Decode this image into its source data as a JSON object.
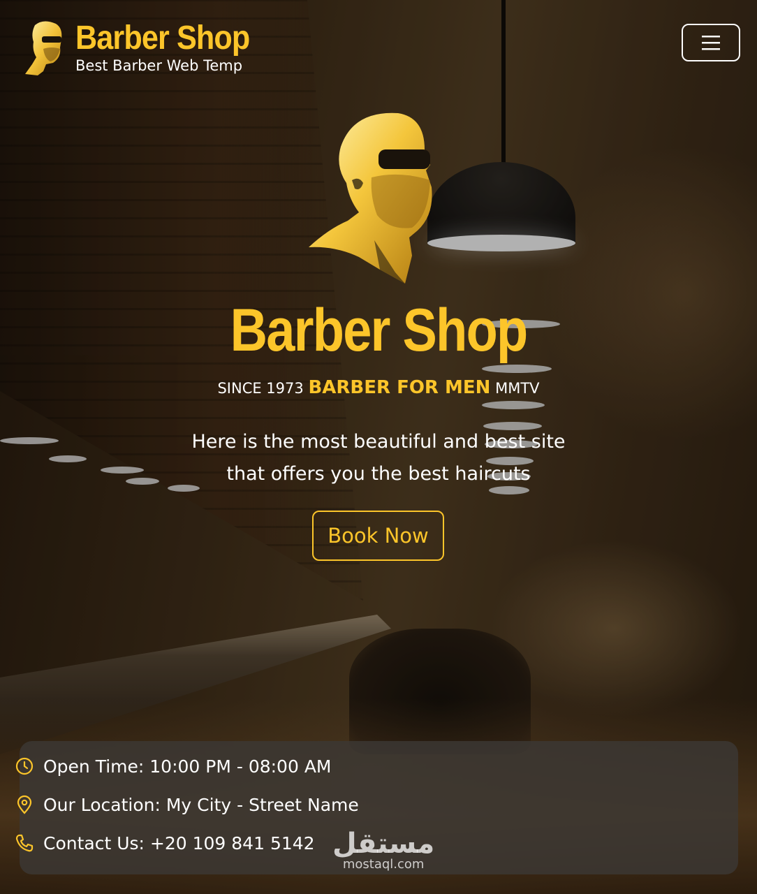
{
  "header": {
    "brand_title": "Barber Shop",
    "brand_subtitle": "Best Barber Web Temp",
    "menu_icon": "hamburger-icon"
  },
  "hero": {
    "title": "Barber Shop",
    "since": "SINCE 1973",
    "accent": "BARBER FOR MEN",
    "suffix": "MMTV",
    "description": "Here is the most beautiful and best site that offers you the best haircuts",
    "cta_label": "Book Now"
  },
  "info": {
    "open_time": "Open Time: 10:00 PM - 08:00 AM",
    "location": "Our Location: My City - Street Name",
    "contact": "Contact Us: +20 109 841 5142"
  },
  "watermark": {
    "arabic": "مستقل",
    "url": "mostaql.com"
  },
  "colors": {
    "accent": "#fcc52a",
    "text": "#ffffff",
    "panel": "#3c3834"
  }
}
